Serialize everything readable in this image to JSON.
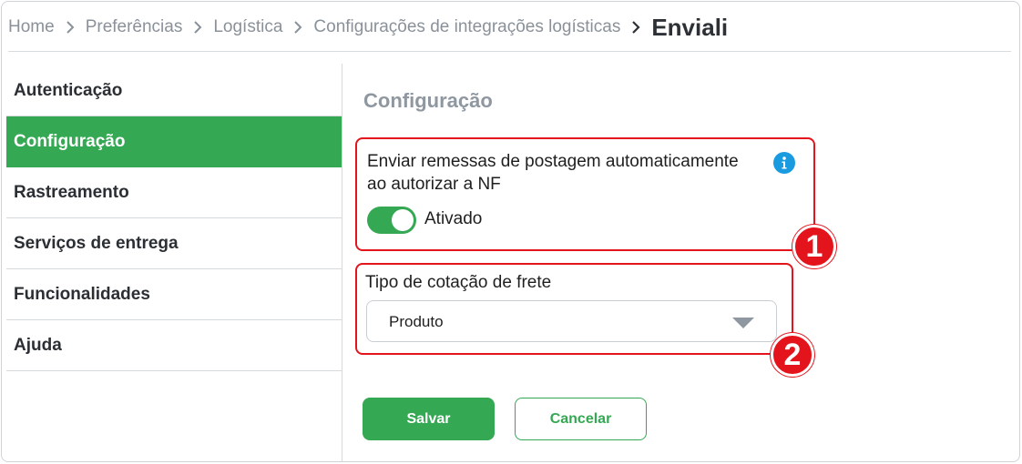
{
  "breadcrumb": {
    "items": [
      "Home",
      "Preferências",
      "Logística",
      "Configurações de integrações logísticas"
    ],
    "current": "Enviali"
  },
  "sidebar": {
    "items": [
      {
        "label": "Autenticação",
        "active": false
      },
      {
        "label": "Configuração",
        "active": true
      },
      {
        "label": "Rastreamento",
        "active": false
      },
      {
        "label": "Serviços de entrega",
        "active": false
      },
      {
        "label": "Funcionalidades",
        "active": false
      },
      {
        "label": "Ajuda",
        "active": false
      }
    ]
  },
  "main": {
    "title": "Configuração",
    "auto_send": {
      "label": "Enviar remessas de postagem automaticamente ao autorizar a NF",
      "toggle_state": "Ativado",
      "info_icon": "info-icon"
    },
    "freight": {
      "label": "Tipo de cotação de frete",
      "selected": "Produto"
    },
    "badges": [
      "1",
      "2"
    ],
    "save_label": "Salvar",
    "cancel_label": "Cancelar"
  },
  "colors": {
    "accent": "#35a853",
    "highlight": "#e3141c",
    "info": "#1a9be0",
    "muted_text": "#8a9199"
  }
}
